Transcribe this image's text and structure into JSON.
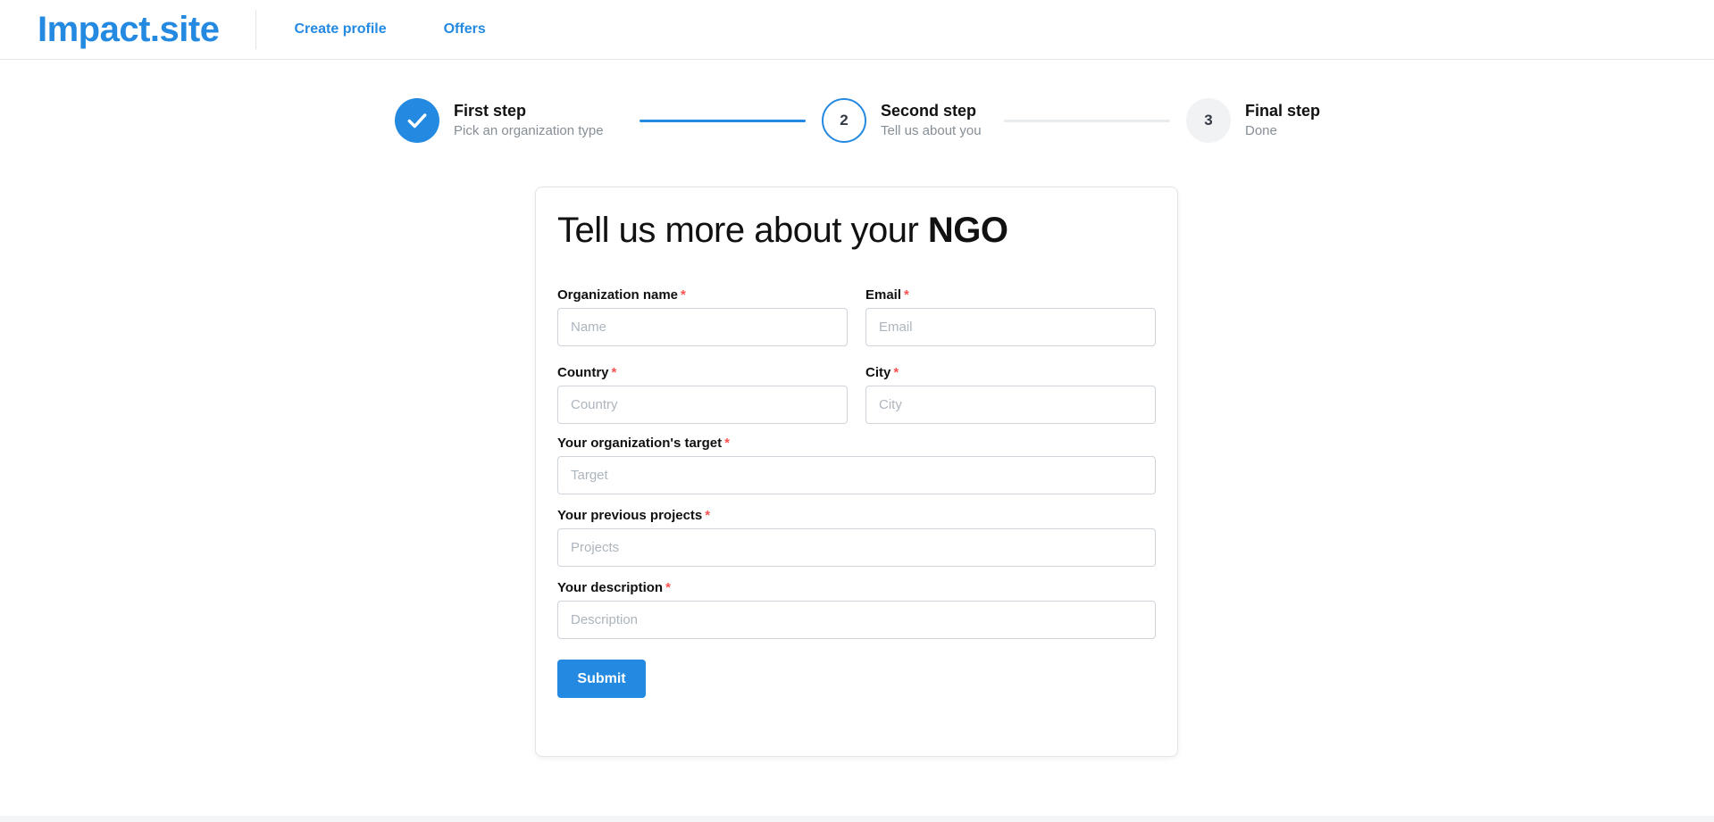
{
  "app": {
    "logo": "Impact.site"
  },
  "nav": {
    "create_profile": "Create profile",
    "offers": "Offers"
  },
  "stepper": {
    "steps": [
      {
        "title": "First step",
        "subtitle": "Pick an organization type",
        "status": "done",
        "number": "1"
      },
      {
        "title": "Second step",
        "subtitle": "Tell us about you",
        "status": "active",
        "number": "2"
      },
      {
        "title": "Final step",
        "subtitle": "Done",
        "status": "pending",
        "number": "3"
      }
    ],
    "icons": {
      "done": "check-icon"
    }
  },
  "form": {
    "heading_prefix": "Tell us more about your ",
    "heading_emphasis": "NGO",
    "required_mark": "*",
    "fields": {
      "org_name": {
        "label": "Organization name",
        "placeholder": "Name",
        "value": ""
      },
      "email": {
        "label": "Email",
        "placeholder": "Email",
        "value": ""
      },
      "country": {
        "label": "Country",
        "placeholder": "Country",
        "value": ""
      },
      "city": {
        "label": "City",
        "placeholder": "City",
        "value": ""
      },
      "target": {
        "label": "Your organization's target",
        "placeholder": "Target",
        "value": ""
      },
      "projects": {
        "label": "Your previous projects",
        "placeholder": "Projects",
        "value": ""
      },
      "description": {
        "label": "Your description",
        "placeholder": "Description",
        "value": ""
      }
    },
    "submit_label": "Submit"
  },
  "colors": {
    "accent": "#2489e0",
    "required": "#fa5252",
    "muted_text": "#868e96",
    "inactive_connector": "#e9ecef"
  }
}
